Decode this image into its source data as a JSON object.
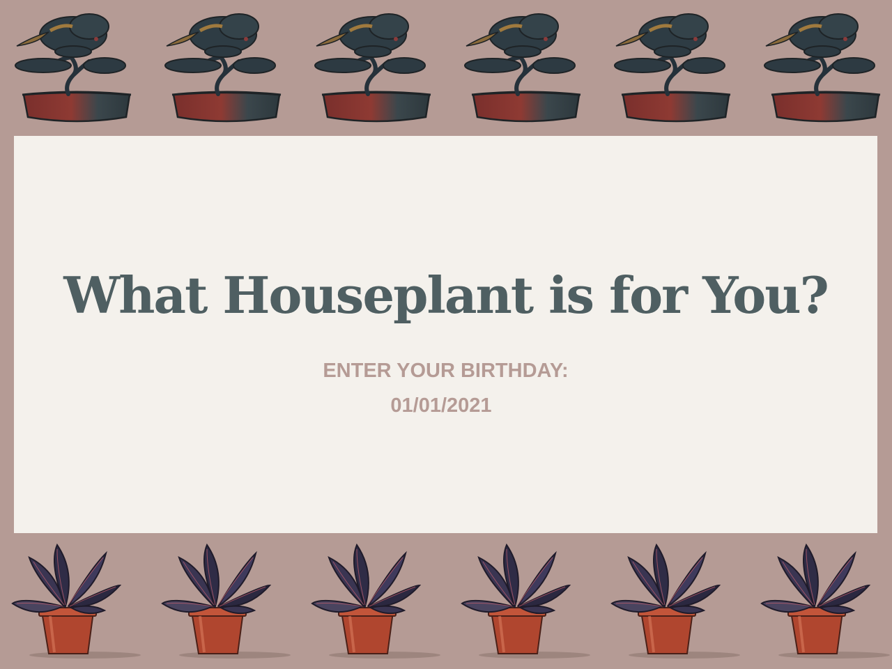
{
  "page": {
    "title": "What Houseplant is for You?",
    "background_color": "#b59b95",
    "card_color": "#f4f1ec",
    "title_color": "#4f5f62",
    "accent_color": "#b59b95"
  },
  "birthday": {
    "label": "ENTER YOUR BIRTHDAY:",
    "value": "01/01/2021"
  },
  "decorations": {
    "top_row_icon": "bonsai-tree-icon",
    "top_row_count": 6,
    "bottom_row_icon": "prayer-plant-icon",
    "bottom_row_count": 6
  }
}
